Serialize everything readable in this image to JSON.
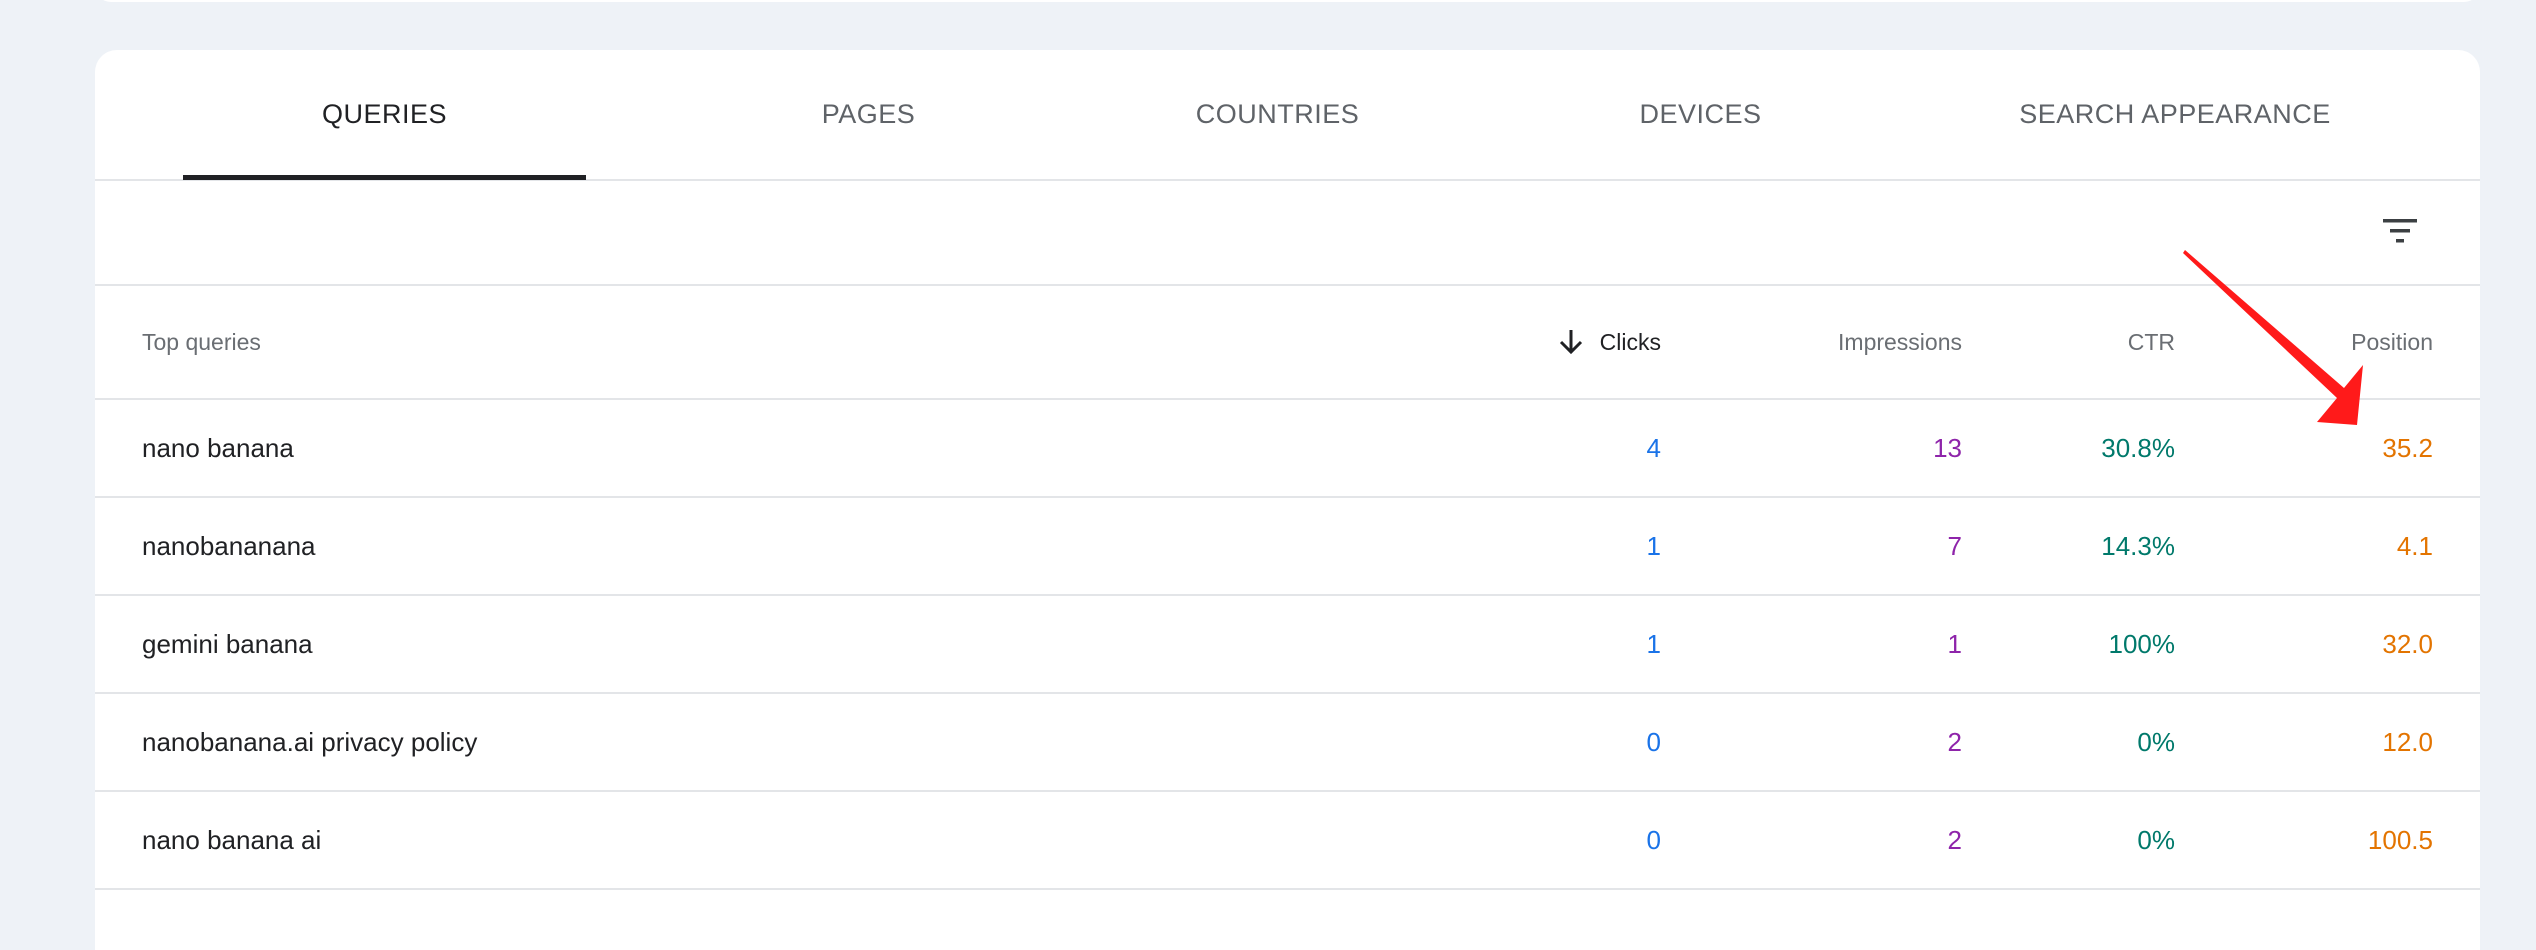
{
  "tabs": [
    {
      "label": "QUERIES",
      "active": true
    },
    {
      "label": "PAGES",
      "active": false
    },
    {
      "label": "COUNTRIES",
      "active": false
    },
    {
      "label": "DEVICES",
      "active": false
    },
    {
      "label": "SEARCH APPEARANCE",
      "active": false
    }
  ],
  "toolbar": {
    "filter_icon": "filter-list-icon"
  },
  "table": {
    "headers": {
      "query": "Top queries",
      "clicks": "Clicks",
      "impressions": "Impressions",
      "ctr": "CTR",
      "position": "Position"
    },
    "sort_icon": "arrow-down-icon",
    "rows": [
      {
        "query": "nano banana",
        "clicks": "4",
        "impressions": "13",
        "ctr": "30.8%",
        "position": "35.2"
      },
      {
        "query": "nanobananana",
        "clicks": "1",
        "impressions": "7",
        "ctr": "14.3%",
        "position": "4.1"
      },
      {
        "query": "gemini banana",
        "clicks": "1",
        "impressions": "1",
        "ctr": "100%",
        "position": "32.0"
      },
      {
        "query": "nanobanana.ai privacy policy",
        "clicks": "0",
        "impressions": "2",
        "ctr": "0%",
        "position": "12.0"
      },
      {
        "query": "nano banana ai",
        "clicks": "0",
        "impressions": "2",
        "ctr": "0%",
        "position": "100.5"
      }
    ]
  },
  "colors": {
    "clicks": "#1a73e8",
    "impressions": "#8e24aa",
    "ctr": "#00796b",
    "position": "#e37400",
    "annotation_arrow": "#ff0000"
  }
}
